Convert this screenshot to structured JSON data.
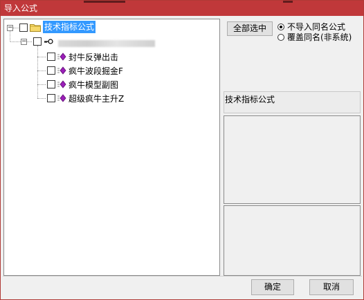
{
  "window": {
    "title": "导入公式"
  },
  "tree": {
    "root": {
      "label": "技术指标公式",
      "expander": "−"
    },
    "group": {
      "expander": "−",
      "key_label": ""
    },
    "items": [
      {
        "label": "封牛反弹出击"
      },
      {
        "label": "疯牛波段掘金F"
      },
      {
        "label": "疯牛模型副图"
      },
      {
        "label": "超级疯牛主升Z"
      }
    ]
  },
  "controls": {
    "select_all": "全部选中",
    "radio_options": [
      {
        "label": "不导入同名公式",
        "checked": true
      },
      {
        "label": "覆盖同名(非系统)",
        "checked": false
      }
    ]
  },
  "info_label": "技术指标公式",
  "buttons": {
    "ok": "确定",
    "cancel": "取消"
  },
  "colors": {
    "title_bar": "#c0383a",
    "selection": "#3399ff",
    "gem": "#9b1fb8"
  }
}
